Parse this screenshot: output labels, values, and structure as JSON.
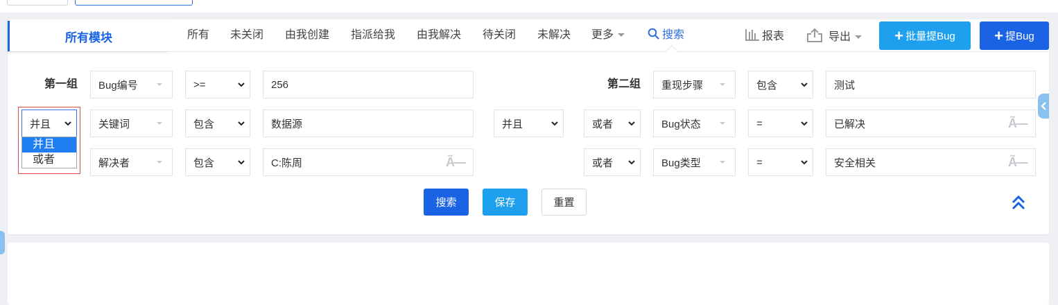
{
  "toolbar": {
    "module_tab": "所有模块",
    "nav": [
      "所有",
      "未关闭",
      "由我创建",
      "指派给我",
      "由我解决",
      "待关闭",
      "未解决"
    ],
    "more": "更多",
    "search": "搜索",
    "report": "报表",
    "export": "导出",
    "batch_bug": "批量提Bug",
    "new_bug": "提Bug"
  },
  "search_form": {
    "group1_label": "第一组",
    "group2_label": "第二组",
    "group1_rows": [
      {
        "field": "Bug编号",
        "operator": ">=",
        "value": "256"
      },
      {
        "andor": "并且",
        "field": "关键词",
        "operator": "包含",
        "value": "数据源"
      },
      {
        "field": "解决者",
        "operator": "包含",
        "value": "C:陈周"
      }
    ],
    "group_and": "并且",
    "group2_rows": [
      {
        "field": "重现步骤",
        "operator": "包含",
        "value": "测试"
      },
      {
        "andor": "或者",
        "field": "Bug状态",
        "operator": "=",
        "value": "已解决"
      },
      {
        "andor": "或者",
        "field": "Bug类型",
        "operator": "=",
        "value": "安全相关"
      }
    ],
    "clear_glyph": "Ã—",
    "dropdown_options": [
      "并且",
      "或者"
    ],
    "buttons": {
      "search": "搜索",
      "save": "保存",
      "reset": "重置"
    }
  },
  "colors": {
    "primary": "#1a63e4",
    "light_primary": "#1ea0ef",
    "highlight_border": "#e04b4b",
    "option_selected": "#1e7ef2"
  }
}
